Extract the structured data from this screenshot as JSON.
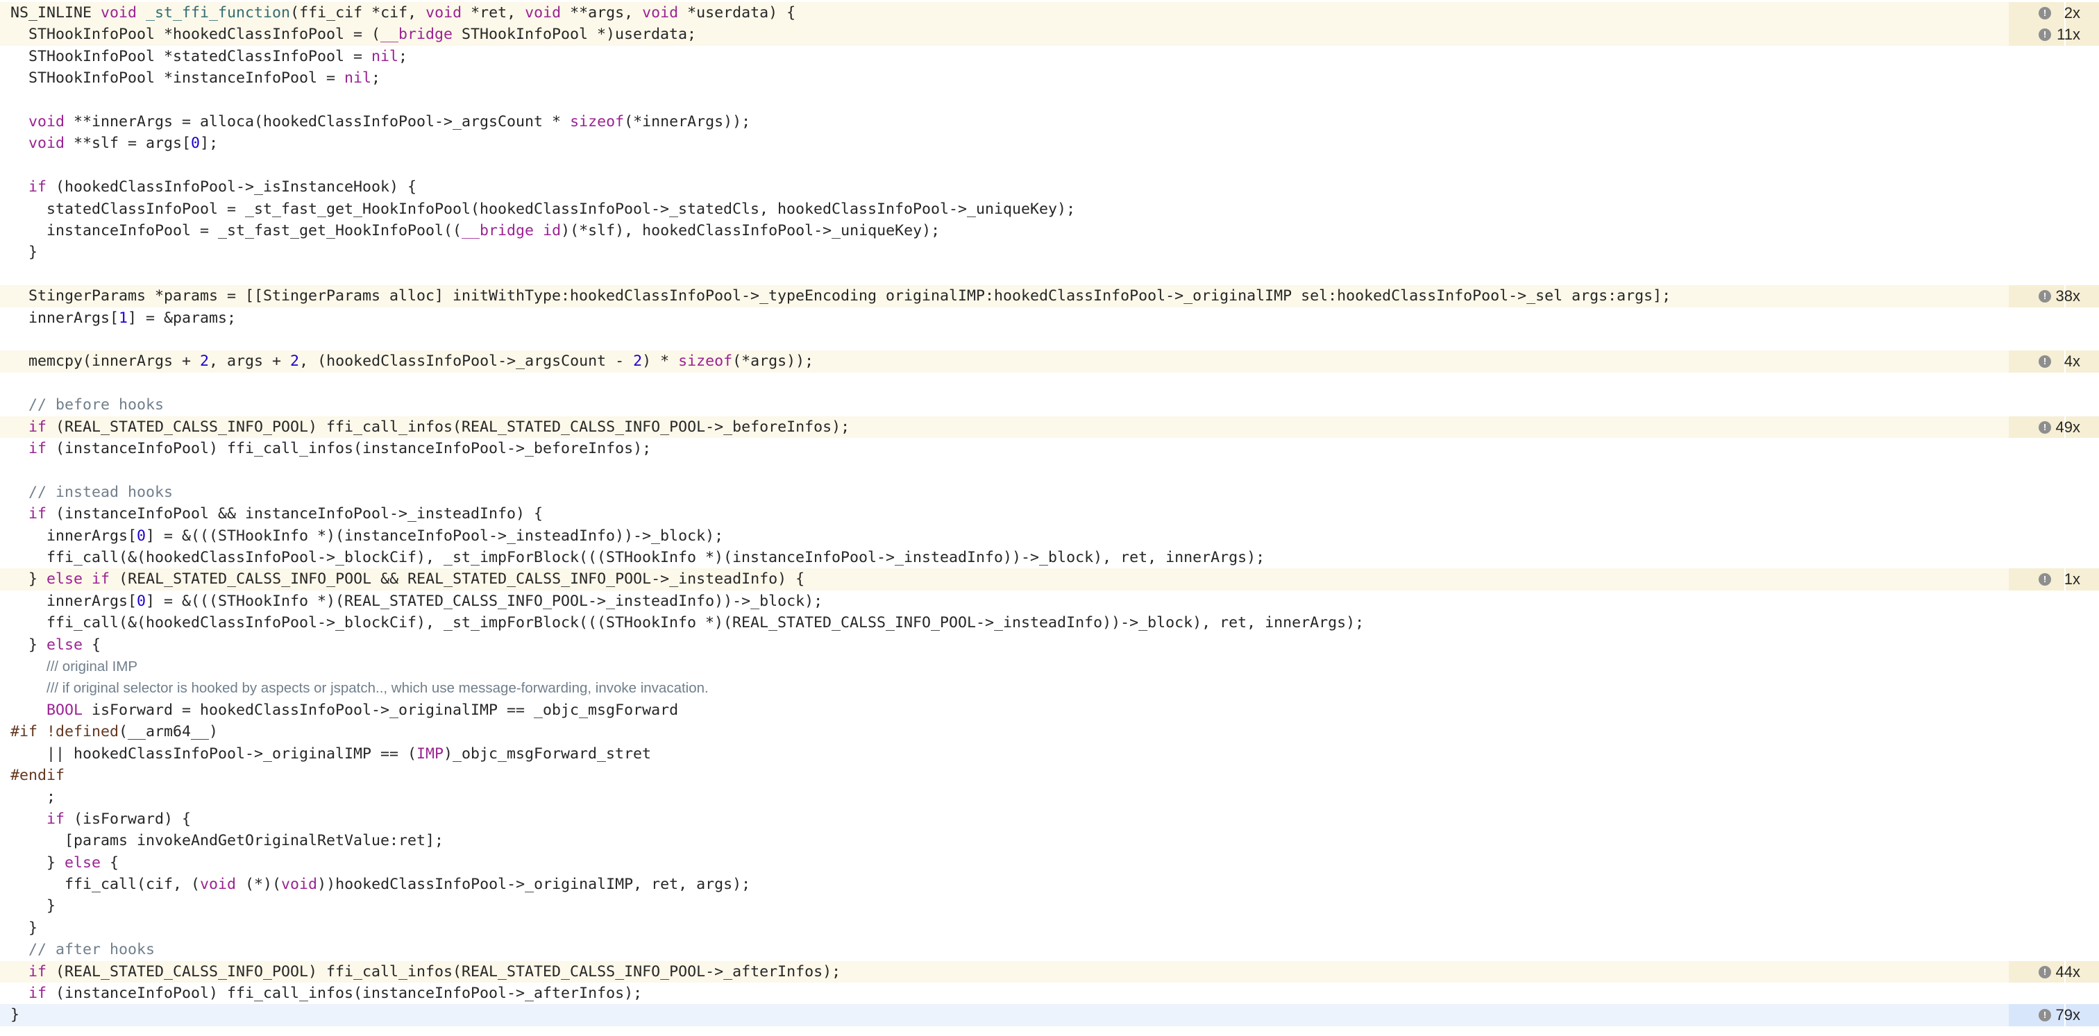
{
  "lines": [
    {
      "text": "NS_INLINE void _st_ffi_function(ffi_cif *cif, void *ret, void **args, void *userdata) {",
      "count": "2x"
    },
    {
      "text": "  STHookInfoPool *hookedClassInfoPool = (__bridge STHookInfoPool *)userdata;",
      "count": "11x"
    },
    {
      "text": "  STHookInfoPool *statedClassInfoPool = nil;"
    },
    {
      "text": "  STHookInfoPool *instanceInfoPool = nil;"
    },
    {
      "text": ""
    },
    {
      "text": "  void **innerArgs = alloca(hookedClassInfoPool->_argsCount * sizeof(*innerArgs));"
    },
    {
      "text": "  void **slf = args[0];"
    },
    {
      "text": ""
    },
    {
      "text": "  if (hookedClassInfoPool->_isInstanceHook) {"
    },
    {
      "text": "    statedClassInfoPool = _st_fast_get_HookInfoPool(hookedClassInfoPool->_statedCls, hookedClassInfoPool->_uniqueKey);"
    },
    {
      "text": "    instanceInfoPool = _st_fast_get_HookInfoPool((__bridge id)(*slf), hookedClassInfoPool->_uniqueKey);"
    },
    {
      "text": "  }"
    },
    {
      "text": ""
    },
    {
      "text": "  StingerParams *params = [[StingerParams alloc] initWithType:hookedClassInfoPool->_typeEncoding originalIMP:hookedClassInfoPool->_originalIMP sel:hookedClassInfoPool->_sel args:args];",
      "count": "38x"
    },
    {
      "text": "  innerArgs[1] = &params;"
    },
    {
      "text": ""
    },
    {
      "text": "  memcpy(innerArgs + 2, args + 2, (hookedClassInfoPool->_argsCount - 2) * sizeof(*args));",
      "count": "4x"
    },
    {
      "text": ""
    },
    {
      "text": "  // before hooks"
    },
    {
      "text": "  if (REAL_STATED_CALSS_INFO_POOL) ffi_call_infos(REAL_STATED_CALSS_INFO_POOL->_beforeInfos);",
      "count": "49x"
    },
    {
      "text": "  if (instanceInfoPool) ffi_call_infos(instanceInfoPool->_beforeInfos);"
    },
    {
      "text": ""
    },
    {
      "text": "  // instead hooks"
    },
    {
      "text": "  if (instanceInfoPool && instanceInfoPool->_insteadInfo) {"
    },
    {
      "text": "    innerArgs[0] = &(((STHookInfo *)(instanceInfoPool->_insteadInfo))->_block);"
    },
    {
      "text": "    ffi_call(&(hookedClassInfoPool->_blockCif), _st_impForBlock(((STHookInfo *)(instanceInfoPool->_insteadInfo))->_block), ret, innerArgs);"
    },
    {
      "text": "  } else if (REAL_STATED_CALSS_INFO_POOL && REAL_STATED_CALSS_INFO_POOL->_insteadInfo) {",
      "count": "1x"
    },
    {
      "text": "    innerArgs[0] = &(((STHookInfo *)(REAL_STATED_CALSS_INFO_POOL->_insteadInfo))->_block);"
    },
    {
      "text": "    ffi_call(&(hookedClassInfoPool->_blockCif), _st_impForBlock(((STHookInfo *)(REAL_STATED_CALSS_INFO_POOL->_insteadInfo))->_block), ret, innerArgs);"
    },
    {
      "text": "  } else {"
    },
    {
      "text": "    /// original IMP"
    },
    {
      "text": "    /// if original selector is hooked by aspects or jspatch.., which use message-forwarding, invoke invacation."
    },
    {
      "text": "    BOOL isForward = hookedClassInfoPool->_originalIMP == _objc_msgForward"
    },
    {
      "text": "#if !defined(__arm64__)"
    },
    {
      "text": "    || hookedClassInfoPool->_originalIMP == (IMP)_objc_msgForward_stret"
    },
    {
      "text": "#endif"
    },
    {
      "text": "    ;"
    },
    {
      "text": "    if (isForward) {"
    },
    {
      "text": "      [params invokeAndGetOriginalRetValue:ret];"
    },
    {
      "text": "    } else {"
    },
    {
      "text": "      ffi_call(cif, (void (*)(void))hookedClassInfoPool->_originalIMP, ret, args);"
    },
    {
      "text": "    }"
    },
    {
      "text": "  }"
    },
    {
      "text": "  // after hooks"
    },
    {
      "text": "  if (REAL_STATED_CALSS_INFO_POOL) ffi_call_infos(REAL_STATED_CALSS_INFO_POOL->_afterInfos);",
      "count": "44x"
    },
    {
      "text": "  if (instanceInfoPool) ffi_call_infos(instanceInfoPool->_afterInfos);"
    },
    {
      "text": "}",
      "count": "79x",
      "current": true
    }
  ],
  "colors": {
    "keyword": "#9b2393",
    "function": "#326d74",
    "number": "#1c00cf",
    "comment": "#707f8c",
    "preprocessor": "#643820",
    "highlight": "#fcf8ea",
    "current_line": "#edf3fc"
  },
  "icons": {
    "info": "info-icon"
  },
  "info_glyph": "!"
}
